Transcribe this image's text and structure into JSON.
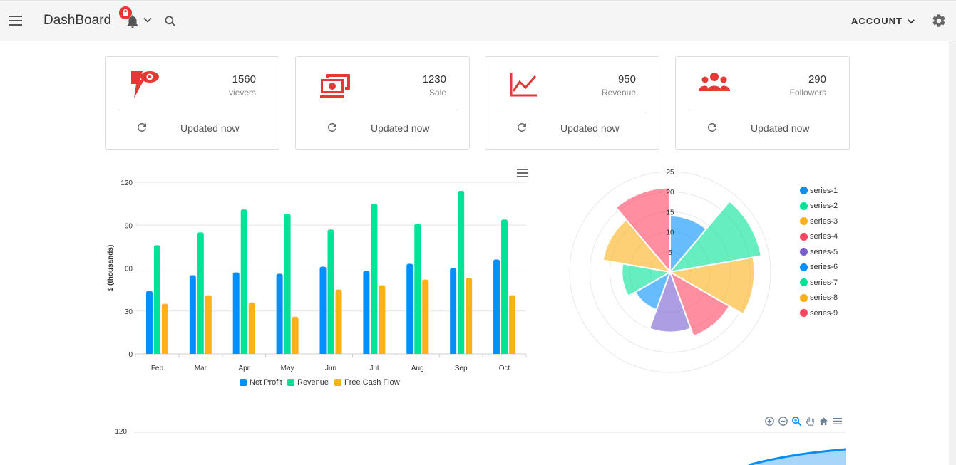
{
  "header": {
    "title": "DashBoard",
    "account_label": "ACCOUNT",
    "icons": [
      "menu-icon",
      "bell-icon",
      "lock-badge-icon",
      "chevron-down-icon",
      "search-icon",
      "chevron-down-icon",
      "gear-icon"
    ]
  },
  "cards": [
    {
      "value": "1560",
      "label": "vievers",
      "footer": "Updated now",
      "icon": "viewers-icon",
      "color": "#e53935"
    },
    {
      "value": "1230",
      "label": "Sale",
      "footer": "Updated now",
      "icon": "money-icon",
      "color": "#e53935"
    },
    {
      "value": "950",
      "label": "Revenue",
      "footer": "Updated now",
      "icon": "line-chart-icon",
      "color": "#e53935"
    },
    {
      "value": "290",
      "label": "Followers",
      "footer": "Updated now",
      "icon": "followers-icon",
      "color": "#e53935"
    }
  ],
  "chart_data": [
    {
      "type": "bar",
      "ylabel": "$ (thousands)",
      "ylim": [
        0,
        120
      ],
      "yticks": [
        "0",
        "30",
        "60",
        "90",
        "120"
      ],
      "categories": [
        "Feb",
        "Mar",
        "Apr",
        "May",
        "Jun",
        "Jul",
        "Aug",
        "Sep",
        "Oct"
      ],
      "series": [
        {
          "name": "Net Profit",
          "color": "#008ffb",
          "values": [
            44,
            55,
            57,
            56,
            61,
            58,
            63,
            60,
            66
          ]
        },
        {
          "name": "Revenue",
          "color": "#00e396",
          "values": [
            76,
            85,
            101,
            98,
            87,
            105,
            91,
            114,
            94
          ]
        },
        {
          "name": "Free Cash Flow",
          "color": "#feb019",
          "values": [
            35,
            41,
            36,
            26,
            45,
            48,
            52,
            53,
            41
          ]
        }
      ],
      "legend_position": "bottom"
    },
    {
      "type": "polarArea",
      "rticks": [
        "5",
        "10",
        "15",
        "20",
        "25"
      ],
      "rmax": 25,
      "series": [
        {
          "name": "series-1",
          "color": "#008ffb",
          "value": 14
        },
        {
          "name": "series-2",
          "color": "#00e396",
          "value": 23
        },
        {
          "name": "series-3",
          "color": "#feb019",
          "value": 21
        },
        {
          "name": "series-4",
          "color": "#ff4560",
          "value": 17
        },
        {
          "name": "series-5",
          "color": "#775dd0",
          "value": 15
        },
        {
          "name": "series-6",
          "color": "#008ffb",
          "value": 10
        },
        {
          "name": "series-7",
          "color": "#00e396",
          "value": 12
        },
        {
          "name": "series-8",
          "color": "#feb019",
          "value": 17
        },
        {
          "name": "series-9",
          "color": "#ff4560",
          "value": 21
        }
      ],
      "legend_position": "right"
    },
    {
      "type": "area",
      "yticks": [
        "120"
      ],
      "toolbar": [
        "zoom-in-icon",
        "zoom-out-icon",
        "zoom-select-icon",
        "pan-hand-icon",
        "home-reset-icon",
        "menu-icon"
      ]
    }
  ]
}
